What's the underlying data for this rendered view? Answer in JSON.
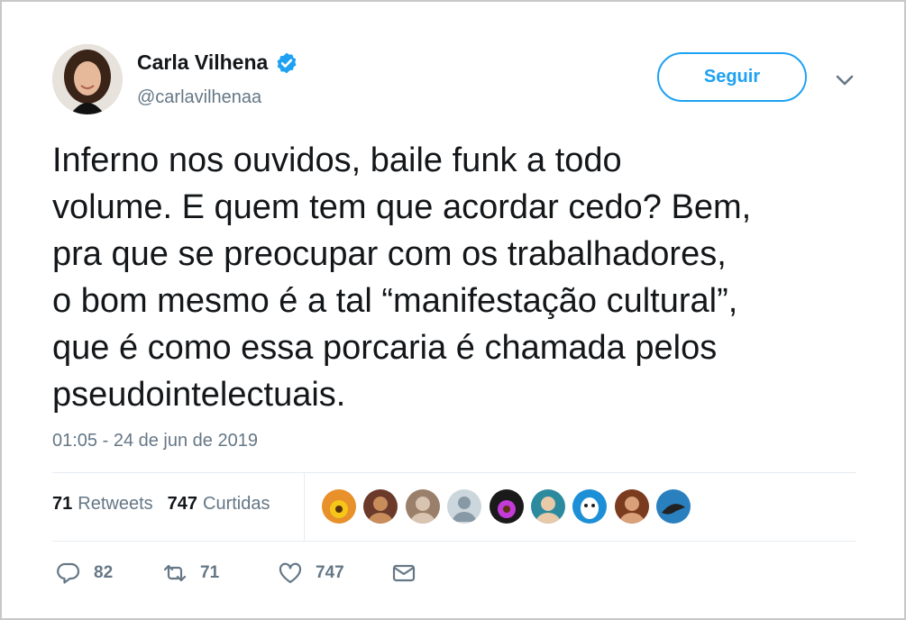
{
  "author": {
    "name": "Carla Vilhena",
    "handle": "@carlavilhenaa",
    "verified": true
  },
  "follow_button": {
    "label": "Seguir"
  },
  "tweet": {
    "text": "Inferno nos ouvidos, baile funk a todo\nvolume. E quem tem que acordar cedo? Bem,\npra que se preocupar com os trabalhadores,\no bom mesmo é a tal “manifestação cultural”,\nque é como essa porcaria é chamada pelos\npseudointelectuais.",
    "timestamp": "01:05 - 24 de jun de 2019"
  },
  "stats": {
    "retweets_count": "71",
    "retweets_label": "Retweets",
    "likes_count": "747",
    "likes_label": "Curtidas"
  },
  "liker_avatars": [
    {
      "icon": "sunflower-avatar",
      "colors": [
        "#e8902a",
        "#f5c518"
      ]
    },
    {
      "icon": "person-avatar",
      "colors": [
        "#6b3a2a",
        "#c98d5c"
      ]
    },
    {
      "icon": "person-avatar",
      "colors": [
        "#9a7f6a",
        "#d8c4b0"
      ]
    },
    {
      "icon": "default-avatar",
      "colors": [
        "#ccd6dd",
        "#8899a6"
      ]
    },
    {
      "icon": "flower-avatar",
      "colors": [
        "#1a1a1a",
        "#c23bd6"
      ]
    },
    {
      "icon": "person-avatar",
      "colors": [
        "#2c8a9e",
        "#e8c9a8"
      ]
    },
    {
      "icon": "cartoon-avatar",
      "colors": [
        "#1d8fd6",
        "#ffffff"
      ]
    },
    {
      "icon": "person-avatar",
      "colors": [
        "#7a3b1e",
        "#d9a07a"
      ]
    },
    {
      "icon": "bird-avatar",
      "colors": [
        "#2a7fbf",
        "#222222"
      ]
    }
  ],
  "actions": {
    "reply_count": "82",
    "retweet_count": "71",
    "like_count": "747"
  },
  "colors": {
    "accent": "#1da1f2",
    "text": "#14171a",
    "secondary": "#657786",
    "divider": "#e6ecf0"
  }
}
